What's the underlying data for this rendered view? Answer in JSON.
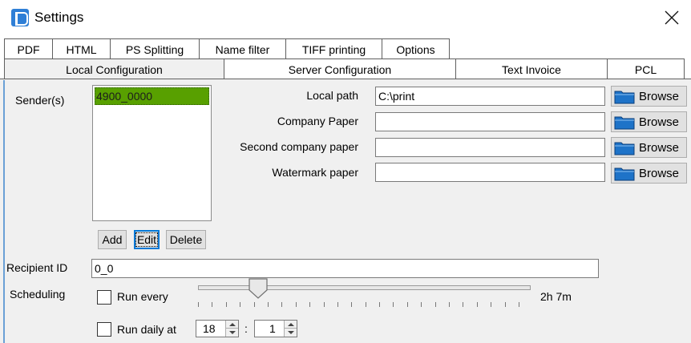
{
  "window": {
    "title": "Settings"
  },
  "tabs": {
    "top_row": [
      "PDF",
      "HTML",
      "PS Splitting",
      "Name filter",
      "TIFF printing",
      "Options"
    ],
    "bottom_row": [
      "Local Configuration",
      "Server Configuration",
      "Text Invoice",
      "PCL"
    ],
    "selected": "Local Configuration"
  },
  "senders": {
    "label": "Sender(s)",
    "items": [
      "4900_0000"
    ],
    "add_label": "Add",
    "edit_label": "Edit",
    "delete_label": "Delete"
  },
  "paths": [
    {
      "label": "Local path",
      "value": "C:\\print",
      "browse_label": "Browse"
    },
    {
      "label": "Company Paper",
      "value": "",
      "browse_label": "Browse"
    },
    {
      "label": "Second company paper",
      "value": "",
      "browse_label": "Browse"
    },
    {
      "label": "Watermark paper",
      "value": "",
      "browse_label": "Browse"
    }
  ],
  "recipient": {
    "label": "Recipient ID",
    "value": "0_0"
  },
  "scheduling": {
    "label": "Scheduling",
    "run_every_label": "Run every",
    "run_every_checked": false,
    "interval_text": "2h 7m",
    "slider_fraction": 0.18,
    "run_daily_label": "Run daily at",
    "run_daily_checked": false,
    "hour": "18",
    "separator": ":",
    "minute": "1"
  },
  "colors": {
    "selected_item": "#58a000",
    "focus": "#0078d7",
    "folder": "#1e73c8"
  },
  "icons": {
    "app": "app-logo-icon",
    "close": "close-icon",
    "browse": "folder-icon"
  }
}
